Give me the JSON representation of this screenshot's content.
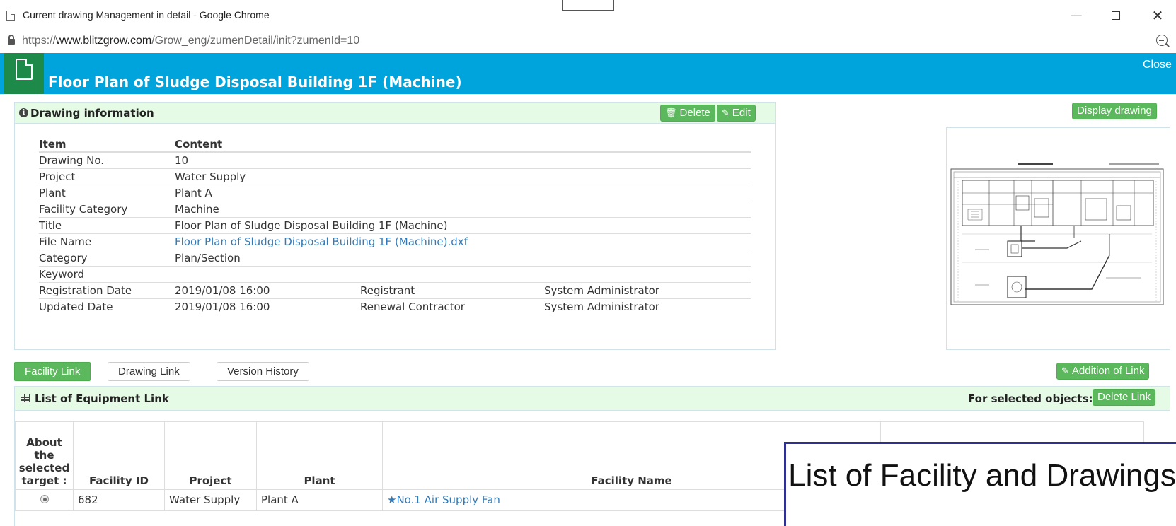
{
  "window": {
    "title": "Current drawing Management in detail - Google Chrome",
    "minimize_glyph": "—",
    "close_glyph": "✕"
  },
  "address": {
    "prefix": "https://",
    "host": "www.blitzgrow.com",
    "path": "/Grow_eng/zumenDetail/init?zumenId=10"
  },
  "header": {
    "title": "Floor Plan of Sludge Disposal Building 1F (Machine)",
    "close_label": "Close"
  },
  "drawing_info": {
    "panel_title": "Drawing information",
    "delete_label": "Delete",
    "edit_label": "Edit",
    "headers": [
      "Item",
      "Content"
    ],
    "rows": [
      {
        "item": "Drawing No.",
        "content": "10"
      },
      {
        "item": "Project",
        "content": "Water Supply"
      },
      {
        "item": "Plant",
        "content": "Plant A"
      },
      {
        "item": "Facility Category",
        "content": "Machine"
      },
      {
        "item": "Title",
        "content": "Floor Plan of Sludge Disposal Building 1F (Machine)"
      },
      {
        "item": "File Name",
        "content": "Floor Plan of Sludge Disposal Building 1F (Machine).dxf"
      },
      {
        "item": "Category",
        "content": "Plan/Section"
      },
      {
        "item": "Keyword",
        "content": ""
      }
    ],
    "registration": {
      "label": "Registration Date",
      "date": "2019/01/08 16:00",
      "role": "Registrant",
      "name": "System Administrator"
    },
    "updated": {
      "label": "Updated Date",
      "date": "2019/01/08 16:00",
      "role": "Renewal Contractor",
      "name": "System Administrator"
    }
  },
  "preview": {
    "display_label": "Display drawing"
  },
  "tabs": {
    "facility": "Facility Link",
    "drawing": "Drawing Link",
    "version": "Version History",
    "add_link": "Addition of Link"
  },
  "equipment_list": {
    "panel_title": "List of Equipment Link",
    "selected_label": "For selected objects:",
    "delete_link_label": "Delete Link",
    "headers": {
      "about": "About the selected target :",
      "facility_id": "Facility ID",
      "project": "Project",
      "plant": "Plant",
      "facility_name": "Facility Name"
    },
    "rows": [
      {
        "facility_id": "682",
        "project": "Water Supply",
        "plant": "Plant A",
        "facility_name": "★No.1 Air Supply Fan"
      }
    ]
  },
  "caption": {
    "text": "List of Facility and Drawings"
  }
}
